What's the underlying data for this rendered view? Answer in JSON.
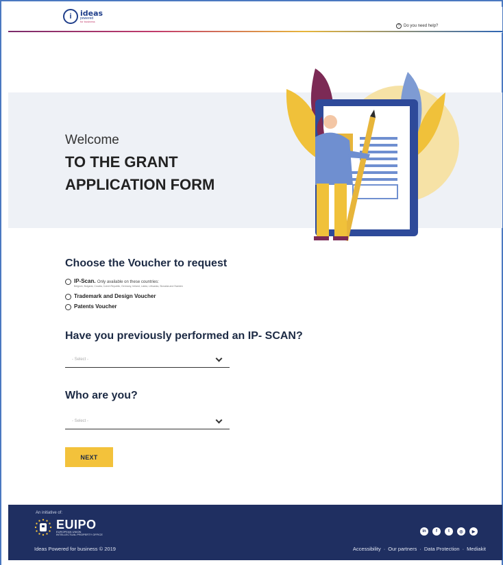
{
  "header": {
    "logo_main": "ideas",
    "logo_sub": "powered",
    "logo_sub2": "for business",
    "help_label": "Do you need help?"
  },
  "hero": {
    "welcome": "Welcome",
    "title_line1": "TO THE GRANT",
    "title_line2": "APPLICATION FORM"
  },
  "voucher": {
    "title": "Choose the Voucher to request",
    "options": [
      {
        "label": "IP-Scan.",
        "note": "Only available on these countries:",
        "sub": "Belgium, Bulgaria, Croatia, Czech Republic, Germany, Ireland, Latvia, Lithuania, Slovakia and Sweden"
      },
      {
        "label": "Trademark and Design Voucher"
      },
      {
        "label": "Patents Voucher"
      }
    ]
  },
  "ipscan": {
    "title": "Have you previously performed an IP- SCAN?",
    "placeholder": "- Select -"
  },
  "who": {
    "title": "Who are you?",
    "placeholder": "- Select -"
  },
  "next_label": "NEXT",
  "footer": {
    "initiative": "An initiative of:",
    "eu_name": "EUIPO",
    "eu_sub1": "EUROPEAN UNION",
    "eu_sub2": "INTELLECTUAL PROPERTY OFFICE",
    "copyright": "Ideas Powered for business © 2019",
    "links": [
      "Accessibility",
      "Our partners",
      "Data Protection",
      "Mediakit"
    ],
    "social": [
      "linkedin-icon",
      "facebook-icon",
      "twitter-icon",
      "instagram-icon",
      "youtube-icon"
    ]
  },
  "colors": {
    "accent": "#f3c23b",
    "footer_bg": "#1f2f61",
    "hero_bg": "#eef1f6",
    "heading": "#1c2a44"
  }
}
